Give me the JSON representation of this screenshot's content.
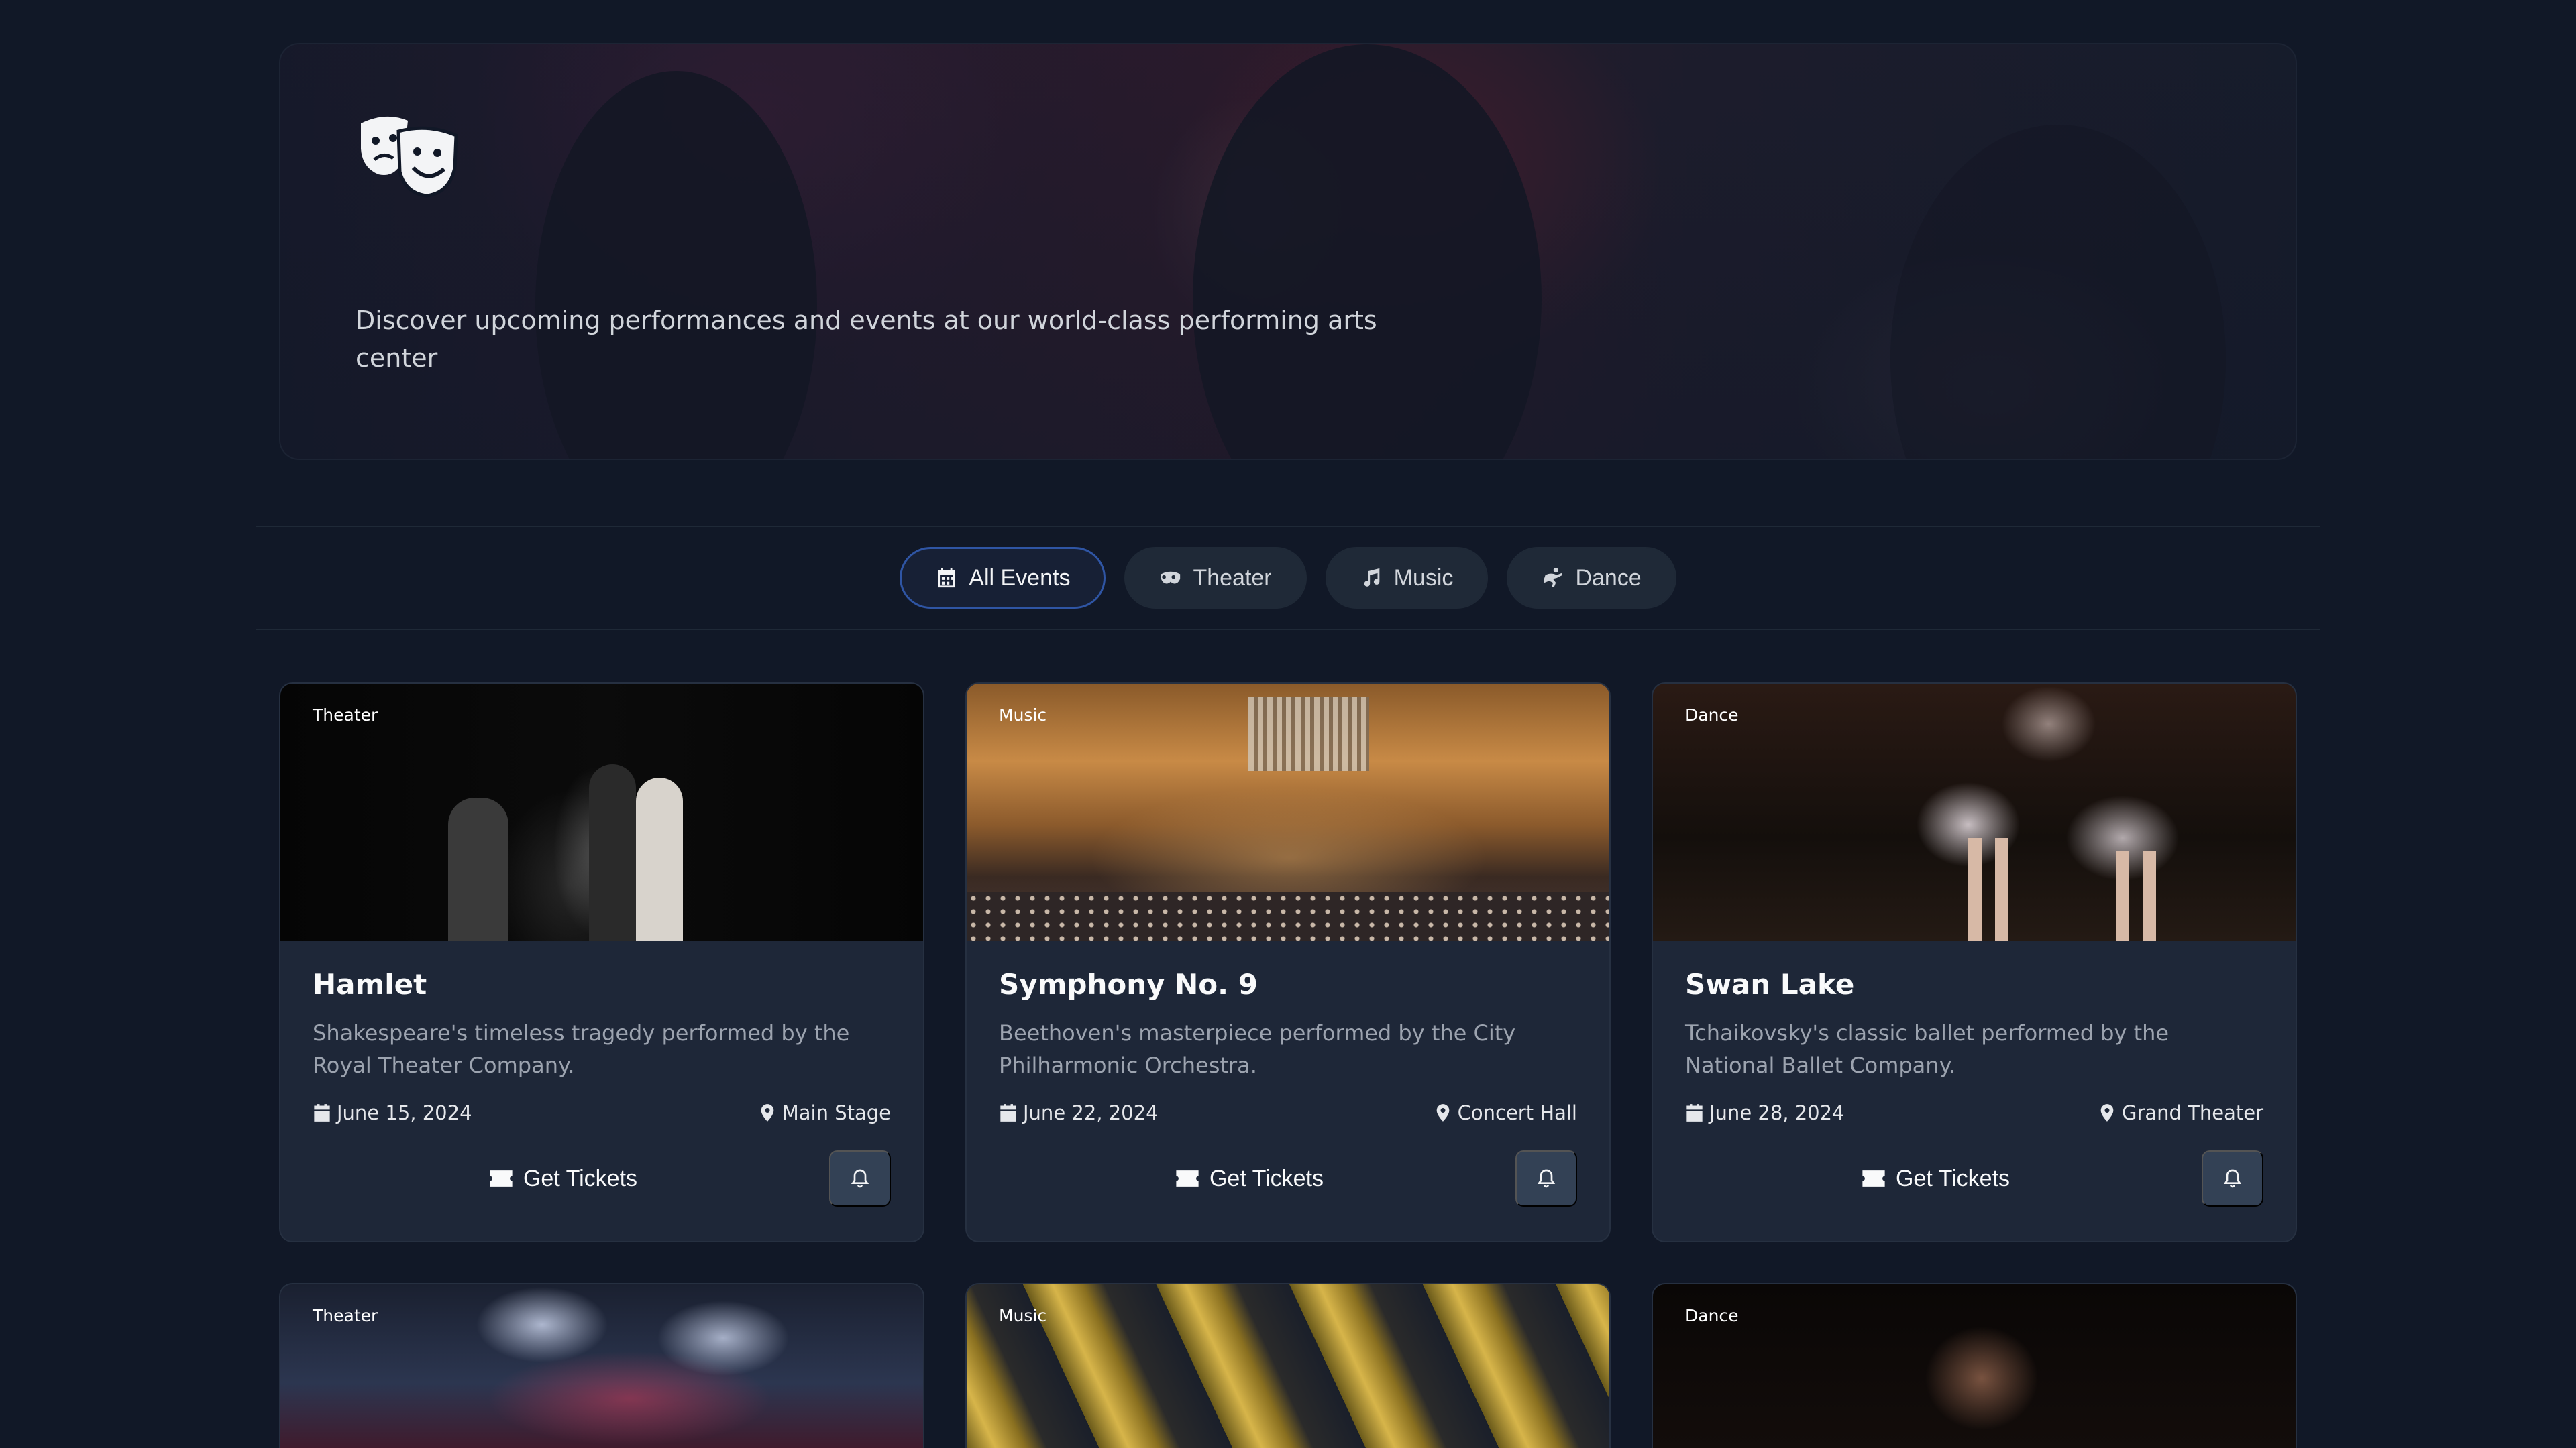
{
  "hero": {
    "logo_icon": "theater-masks-icon",
    "description": "Discover upcoming performances and events at our world-class performing arts center"
  },
  "filters": [
    {
      "label": "All Events",
      "icon": "calendar-icon",
      "active": true
    },
    {
      "label": "Theater",
      "icon": "mask-icon",
      "active": false
    },
    {
      "label": "Music",
      "icon": "music-note-icon",
      "active": false
    },
    {
      "label": "Dance",
      "icon": "dance-icon",
      "active": false
    }
  ],
  "events": [
    {
      "category": "Theater",
      "title": "Hamlet",
      "description": "Shakespeare's timeless tragedy performed by the Royal Theater Company.",
      "date": "June 15, 2024",
      "venue": "Main Stage",
      "tickets_label": "Get Tickets"
    },
    {
      "category": "Music",
      "title": "Symphony No. 9",
      "description": "Beethoven's masterpiece performed by the City Philharmonic Orchestra.",
      "date": "June 22, 2024",
      "venue": "Concert Hall",
      "tickets_label": "Get Tickets"
    },
    {
      "category": "Dance",
      "title": "Swan Lake",
      "description": "Tchaikovsky's classic ballet performed by the National Ballet Company.",
      "date": "June 28, 2024",
      "venue": "Grand Theater",
      "tickets_label": "Get Tickets"
    },
    {
      "category": "Theater"
    },
    {
      "category": "Music"
    },
    {
      "category": "Dance"
    }
  ]
}
